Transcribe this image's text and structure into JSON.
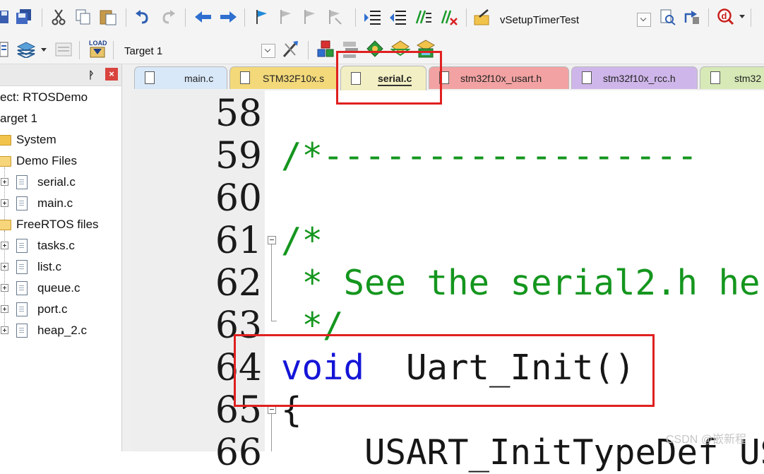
{
  "toolbar": {
    "function_dropdown": "vSetupTimerTest",
    "target_dropdown": "Target 1"
  },
  "project": {
    "root_label": "ect: RTOSDemo",
    "target_label": "arget 1",
    "groups": [
      {
        "name": "System",
        "files": []
      },
      {
        "name": "Demo Files",
        "files": [
          "serial.c",
          "main.c"
        ]
      },
      {
        "name": "FreeRTOS files",
        "files": [
          "tasks.c",
          "list.c",
          "queue.c",
          "port.c",
          "heap_2.c"
        ]
      }
    ]
  },
  "tabs": [
    {
      "label": "main.c",
      "color": "#d8e8f8"
    },
    {
      "label": "STM32F10x.s",
      "color": "#f3d97a"
    },
    {
      "label": "serial.c",
      "color": "#f2efc4",
      "active": true
    },
    {
      "label": "stm32f10x_usart.h",
      "color": "#f2a2a2"
    },
    {
      "label": "stm32f10x_rcc.h",
      "color": "#cfb6ea"
    },
    {
      "label": "stm32",
      "color": "#d6e9b6"
    }
  ],
  "editor": {
    "lines": [
      {
        "num": "58",
        "code": ""
      },
      {
        "num": "59",
        "code": "/*------------------"
      },
      {
        "num": "60",
        "code": ""
      },
      {
        "num": "61",
        "code": "/*"
      },
      {
        "num": "62",
        "code": " * See the serial2.h he"
      },
      {
        "num": "63",
        "code": " */"
      },
      {
        "num": "64",
        "kw": "void",
        "code": "  Uart_Init()"
      },
      {
        "num": "65",
        "code": "{"
      },
      {
        "num": "66",
        "code": "    USART_InitTypeDef US"
      }
    ]
  },
  "colors": {
    "comment": "#14961e",
    "keyword": "#1414d8",
    "highlight_box": "#e02020"
  },
  "watermark": "CSDN @嵌新程"
}
